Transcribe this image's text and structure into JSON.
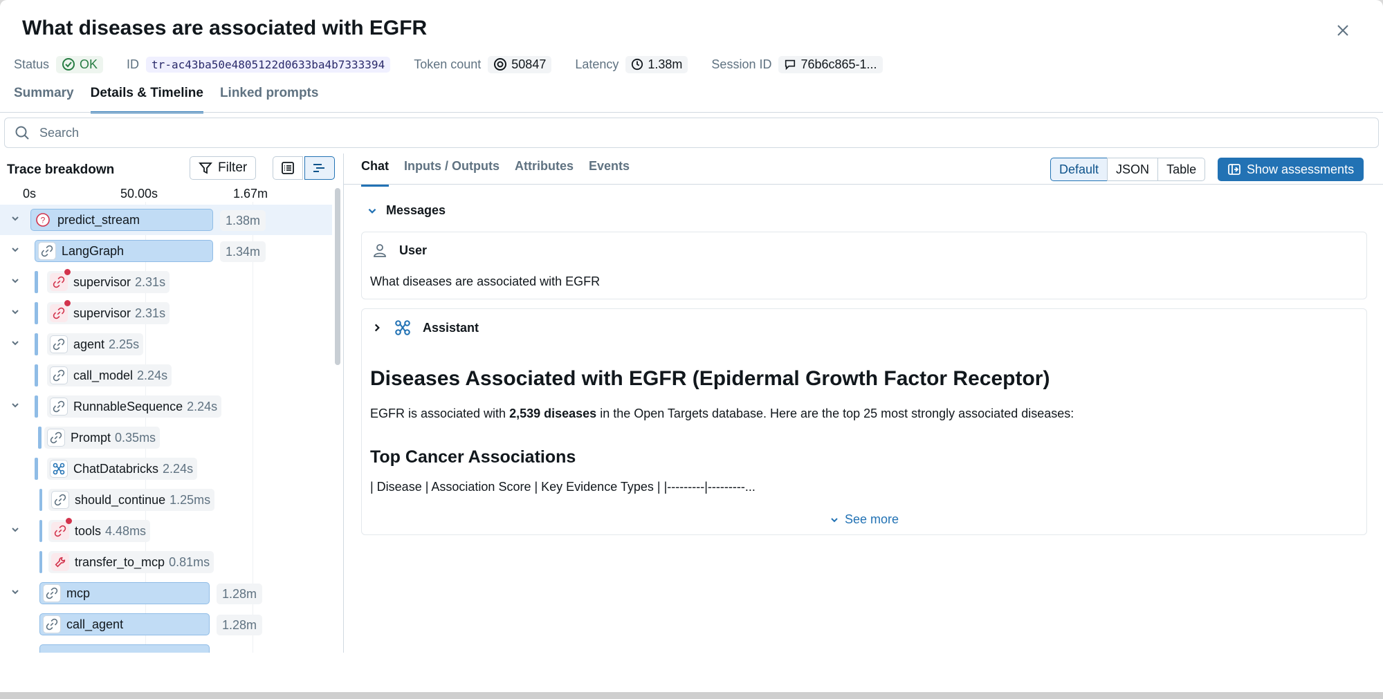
{
  "title": "What diseases are associated with EGFR",
  "meta": {
    "status_label": "Status",
    "status_value": "OK",
    "id_label": "ID",
    "id_value": "tr-ac43ba50e4805122d0633ba4b7333394",
    "token_label": "Token count",
    "token_value": "50847",
    "latency_label": "Latency",
    "latency_value": "1.38m",
    "session_label": "Session ID",
    "session_value": "76b6c865-1..."
  },
  "tabs": [
    {
      "label": "Summary"
    },
    {
      "label": "Details & Timeline"
    },
    {
      "label": "Linked prompts"
    }
  ],
  "search": {
    "placeholder": "Search"
  },
  "trace": {
    "title": "Trace breakdown",
    "filter_label": "Filter",
    "axis": [
      "0s",
      "50.00s",
      "1.67m"
    ],
    "spans": [
      {
        "name": "predict_stream",
        "duration": "1.38m"
      },
      {
        "name": "LangGraph",
        "duration": "1.34m"
      },
      {
        "name": "supervisor",
        "duration": "2.31s"
      },
      {
        "name": "supervisor",
        "duration": "2.31s"
      },
      {
        "name": "agent",
        "duration": "2.25s"
      },
      {
        "name": "call_model",
        "duration": "2.24s"
      },
      {
        "name": "RunnableSequence",
        "duration": "2.24s"
      },
      {
        "name": "Prompt",
        "duration": "0.35ms"
      },
      {
        "name": "ChatDatabricks",
        "duration": "2.24s"
      },
      {
        "name": "should_continue",
        "duration": "1.25ms"
      },
      {
        "name": "tools",
        "duration": "4.48ms"
      },
      {
        "name": "transfer_to_mcp",
        "duration": "0.81ms"
      },
      {
        "name": "mcp",
        "duration": "1.28m"
      },
      {
        "name": "call_agent",
        "duration": "1.28m"
      }
    ]
  },
  "right_tabs": [
    {
      "label": "Chat"
    },
    {
      "label": "Inputs / Outputs"
    },
    {
      "label": "Attributes"
    },
    {
      "label": "Events"
    }
  ],
  "view_modes": [
    "Default",
    "JSON",
    "Table"
  ],
  "assess_label": "Show assessments",
  "messages": {
    "header": "Messages",
    "user_role": "User",
    "user_text": "What diseases are associated with EGFR",
    "assistant_role": "Assistant",
    "heading": "Diseases Associated with EGFR (Epidermal Growth Factor Receptor)",
    "para_pre": "EGFR is associated with ",
    "para_bold": "2,539 diseases",
    "para_post": " in the Open Targets database. Here are the top 25 most strongly associated diseases:",
    "subheading": "Top Cancer Associations",
    "table_line": "| Disease | Association Score | Key Evidence Types | |---------|---------...",
    "see_more": "See more"
  }
}
